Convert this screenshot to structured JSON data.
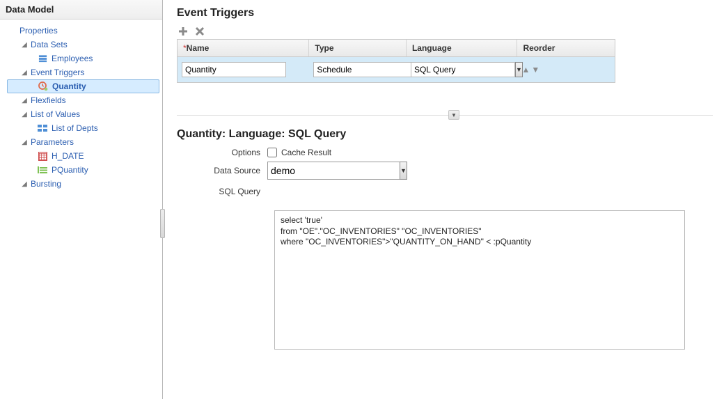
{
  "sidebar": {
    "title": "Data Model",
    "properties_label": "Properties",
    "nodes": {
      "data_sets": "Data Sets",
      "employees": "Employees",
      "event_triggers": "Event Triggers",
      "quantity": "Quantity",
      "flexfields": "Flexfields",
      "list_of_values": "List of Values",
      "list_of_depts": "List of Depts",
      "parameters": "Parameters",
      "h_date": "H_DATE",
      "pquantity": "PQuantity",
      "bursting": "Bursting"
    }
  },
  "main": {
    "section_title": "Event Triggers",
    "table": {
      "headers": {
        "name": "Name",
        "type": "Type",
        "language": "Language",
        "reorder": "Reorder"
      },
      "row": {
        "name": "Quantity",
        "type": "Schedule",
        "language": "SQL Query"
      }
    },
    "detail": {
      "title": "Quantity: Language: SQL Query",
      "labels": {
        "options": "Options",
        "cache_result": "Cache Result",
        "data_source": "Data Source",
        "sql_query": "SQL Query"
      },
      "data_source_value": "demo",
      "sql_text": "select 'true'\nfrom \"OE\".\"OC_INVENTORIES\" \"OC_INVENTORIES\"\nwhere \"OC_INVENTORIES\">\"QUANTITY_ON_HAND\" < :pQuantity"
    }
  }
}
